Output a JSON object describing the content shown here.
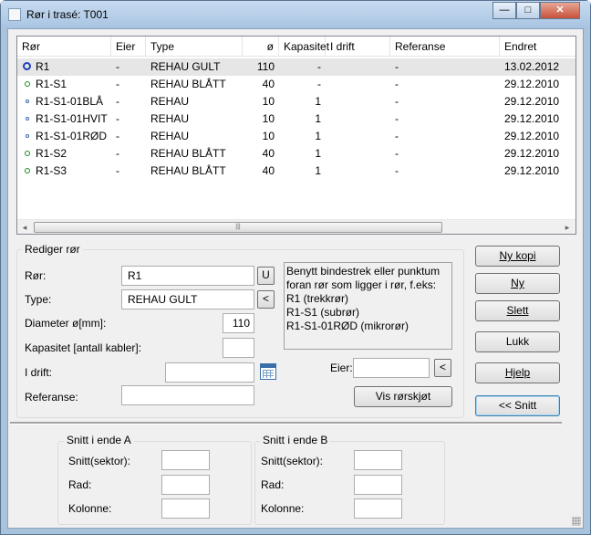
{
  "window": {
    "title": "Rør i trasé: T001",
    "minimize_glyph": "—",
    "maximize_glyph": "□",
    "close_glyph": "✕"
  },
  "table": {
    "columns": [
      "Rør",
      "Eier",
      "Type",
      "ø",
      "Kapasitet",
      "I drift",
      "Referanse",
      "Endret"
    ],
    "rows": [
      {
        "ror": "R1",
        "eier": "-",
        "type": "REHAU GULT",
        "diameter": "110",
        "kapasitet": "-",
        "idrift": "",
        "referanse": "-",
        "endret": "13.02.2012",
        "icon": "big"
      },
      {
        "ror": "R1-S1",
        "eier": "-",
        "type": "REHAU BLÅTT",
        "diameter": "40",
        "kapasitet": "-",
        "idrift": "",
        "referanse": "-",
        "endret": "29.12.2010",
        "icon": "med"
      },
      {
        "ror": "R1-S1-01BLÅ",
        "eier": "-",
        "type": "REHAU",
        "diameter": "10",
        "kapasitet": "1",
        "idrift": "",
        "referanse": "-",
        "endret": "29.12.2010",
        "icon": "sm"
      },
      {
        "ror": "R1-S1-01HVIT",
        "eier": "-",
        "type": "REHAU",
        "diameter": "10",
        "kapasitet": "1",
        "idrift": "",
        "referanse": "-",
        "endret": "29.12.2010",
        "icon": "sm"
      },
      {
        "ror": "R1-S1-01RØD",
        "eier": "-",
        "type": "REHAU",
        "diameter": "10",
        "kapasitet": "1",
        "idrift": "",
        "referanse": "-",
        "endret": "29.12.2010",
        "icon": "sm"
      },
      {
        "ror": "R1-S2",
        "eier": "-",
        "type": "REHAU BLÅTT",
        "diameter": "40",
        "kapasitet": "1",
        "idrift": "",
        "referanse": "-",
        "endret": "29.12.2010",
        "icon": "med"
      },
      {
        "ror": "R1-S3",
        "eier": "-",
        "type": "REHAU BLÅTT",
        "diameter": "40",
        "kapasitet": "1",
        "idrift": "",
        "referanse": "-",
        "endret": "29.12.2010",
        "icon": "med"
      }
    ],
    "scroll_left_glyph": "◂",
    "scroll_right_glyph": "▸",
    "thumb_grip": "|||"
  },
  "edit": {
    "legend": "Rediger rør",
    "ror_label": "Rør:",
    "ror_value": "R1",
    "ror_btn": "U",
    "type_label": "Type:",
    "type_value": "REHAU GULT",
    "type_btn": "<",
    "diameter_label": "Diameter ø[mm]:",
    "diameter_value": "110",
    "kapasitet_label": "Kapasitet [antall kabler]:",
    "kapasitet_value": "",
    "idrift_label": "I drift:",
    "idrift_value": "",
    "referanse_label": "Referanse:",
    "referanse_value": "",
    "eier_label": "Eier:",
    "eier_value": "",
    "eier_btn": "<",
    "vis_btn": "Vis rørskjøt",
    "info_lines": [
      "Benytt bindestrek eller punktum",
      "foran rør som ligger i rør, f.eks:",
      "R1 (trekkrør)",
      "R1-S1 (subrør)",
      "R1-S1-01RØD (mikrorør)"
    ]
  },
  "buttons": {
    "ny_kopi": "Ny kopi",
    "ny": "Ny",
    "slett": "Slett",
    "lukk": "Lukk",
    "hjelp": "Hjelp",
    "snitt": "<< Snitt"
  },
  "snitt_a": {
    "legend": "Snitt i ende A",
    "sektor_label": "Snitt(sektor):",
    "rad_label": "Rad:",
    "kolonne_label": "Kolonne:",
    "sektor_value": "",
    "rad_value": "",
    "kolonne_value": ""
  },
  "snitt_b": {
    "legend": "Snitt i ende B",
    "sektor_label": "Snitt(sektor):",
    "rad_label": "Rad:",
    "kolonne_label": "Kolonne:",
    "sektor_value": "",
    "rad_value": "",
    "kolonne_value": ""
  }
}
